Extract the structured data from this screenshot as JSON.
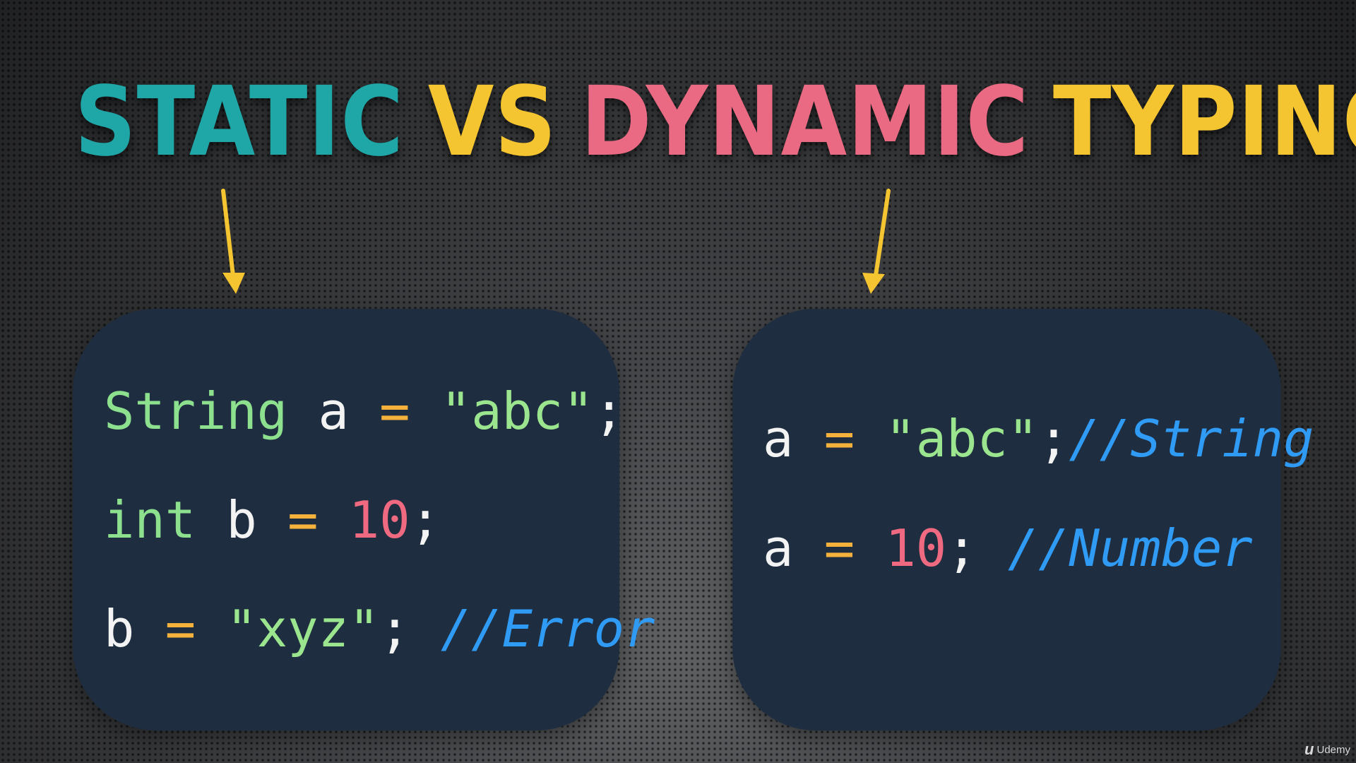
{
  "title": {
    "word1": "STATIC",
    "word2": "VS",
    "word3": "DYNAMIC",
    "word4": "TYPING"
  },
  "static_panel": {
    "line1": {
      "type": "String",
      "var": "a",
      "op": "=",
      "value": "\"abc\"",
      "semi": ";"
    },
    "line2": {
      "type": "int",
      "var": "b",
      "op": "=",
      "value": "10",
      "semi": ";"
    },
    "line3": {
      "var": "b",
      "op": "=",
      "value": "\"xyz\"",
      "semi": ";",
      "comment": "//Error"
    }
  },
  "dynamic_panel": {
    "line1": {
      "var": "a",
      "op": "=",
      "value": "\"abc\"",
      "semi": ";",
      "comment": "//String"
    },
    "line2": {
      "var": "a",
      "op": "=",
      "value": "10",
      "semi": ";",
      "comment": "//Number"
    }
  },
  "watermark": {
    "icon": "udemy-logo-icon",
    "label": "Udemy"
  },
  "colors": {
    "static": "#1fa7a8",
    "vs": "#f4c531",
    "dynamic": "#e96a82",
    "typing": "#f4c531",
    "panel": "#1e2d40",
    "arrow_yellow": "#f4c531",
    "arrow_green": "#36b477",
    "comment": "#2f9bf5",
    "number": "#ef6a80",
    "string": "#9be58f",
    "operator": "#f4b23c"
  }
}
